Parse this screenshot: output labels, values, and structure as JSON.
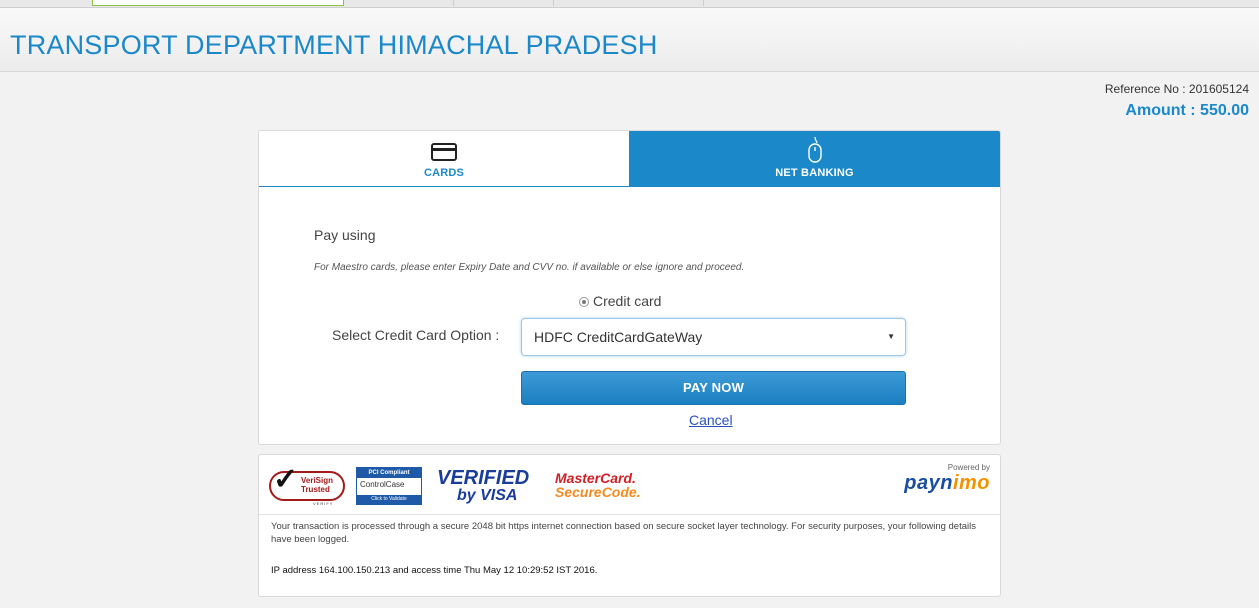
{
  "header": {
    "title": "TRANSPORT DEPARTMENT HIMACHAL PRADESH"
  },
  "summary": {
    "reference": "Reference No : 201605124",
    "amount": "Amount : 550.00"
  },
  "tabs": [
    {
      "label": "CARDS",
      "icon": "credit-card-icon",
      "active": true
    },
    {
      "label": "NET BANKING",
      "icon": "mouse-icon",
      "active": false
    }
  ],
  "form": {
    "pay_using": "Pay using",
    "maestro_note": "For Maestro cards, please enter Expiry Date and CVV no. if available or else ignore and proceed.",
    "radio_label": "Credit card",
    "select_label": "Select Credit Card Option :",
    "select_value": "HDFC CreditCardGateWay",
    "pay_button": "PAY NOW",
    "cancel_link": "Cancel"
  },
  "logos": {
    "verisign_line1": "VeriSign",
    "verisign_line2": "Trusted",
    "verisign_line3": "VERIFY",
    "pci_top": "PCI Compliant",
    "pci_mid": "ControlCase",
    "pci_bottom": "Click to Validate",
    "visa_line1": "VERIFIED",
    "visa_line2": "by VISA",
    "mastercard_line1": "MasterCard.",
    "mastercard_line2": "SecureCode.",
    "powered_by": "Powered by",
    "paynimo_pay": "payn",
    "paynimo_imo": "imo"
  },
  "footer": {
    "secure_text": "Your transaction is processed through a secure 2048 bit https internet connection based on secure socket layer technology. For security purposes, your following details have been logged.",
    "ip_text": "IP address 164.100.150.213 and access time Thu May 12 10:29:52 IST 2016."
  },
  "colors": {
    "brand_blue": "#1b88c9",
    "link_blue": "#2a4fc0",
    "mastercard_red": "#cf1f25",
    "mastercard_orange": "#f38b20"
  }
}
